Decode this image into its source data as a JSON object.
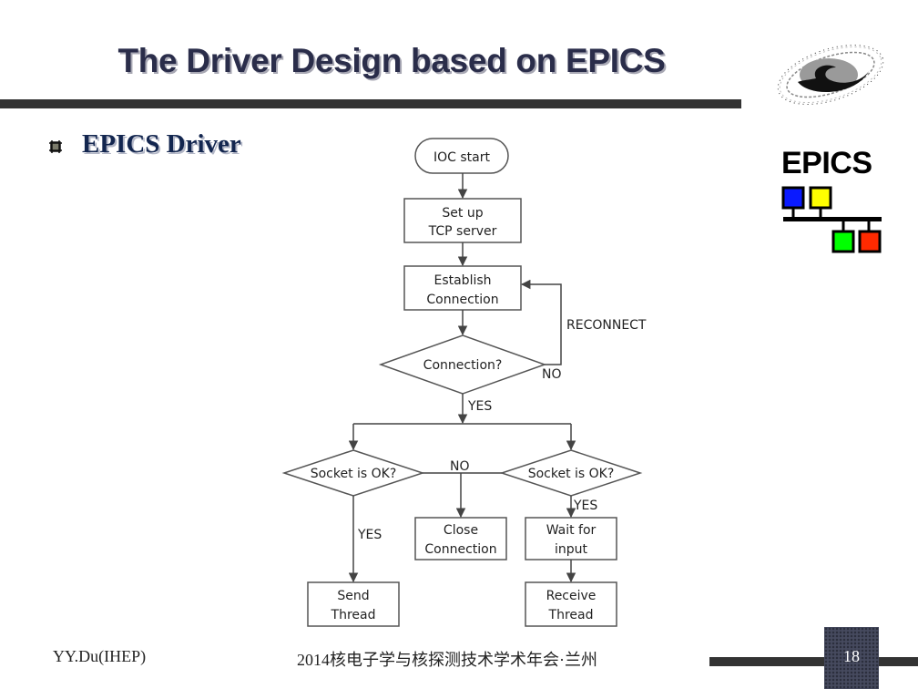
{
  "slide": {
    "title": "The Driver Design based on EPICS",
    "bullet": "EPICS Driver",
    "logo_text": "EPICS",
    "epics_node_colors": [
      "#0a1aff",
      "#ffff00",
      "#00ff00",
      "#ff2a00"
    ],
    "footer_author": "YY.Du(IHEP)",
    "footer_event": "2014核电子学与核探测技术学术年会·兰州",
    "page_number": "18"
  },
  "flowchart": {
    "nodes": {
      "ioc_start": "IOC start",
      "setup_tcp_l1": "Set up",
      "setup_tcp_l2": "TCP server",
      "establish_l1": "Establish",
      "establish_l2": "Connection",
      "connection_q": "Connection?",
      "socket_ok_left": "Socket is OK?",
      "socket_ok_right": "Socket is OK?",
      "close_l1": "Close",
      "close_l2": "Connection",
      "wait_l1": "Wait for",
      "wait_l2": "input",
      "send_l1": "Send",
      "send_l2": "Thread",
      "receive_l1": "Receive",
      "receive_l2": "Thread"
    },
    "edge_labels": {
      "reconnect": "RECONNECT",
      "no_connection": "NO",
      "yes_connection": "YES",
      "no_socket": "NO",
      "yes_send": "YES",
      "yes_receive": "YES"
    }
  }
}
